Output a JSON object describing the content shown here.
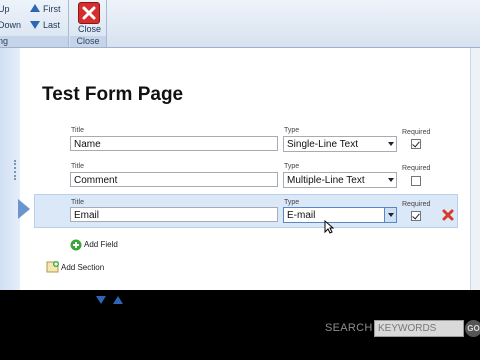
{
  "ribbon": {
    "up_label": "Up",
    "first_label": "First",
    "down_label": "Down",
    "last_label": "Last",
    "group_label_left": "ng",
    "close_label": "Close",
    "close_group_label": "Close"
  },
  "page": {
    "title": "Test Form Page"
  },
  "fields": [
    {
      "title_label": "Title",
      "title_value": "Name",
      "type_label": "Type",
      "type_value": "Single-Line Text",
      "required_label": "Required",
      "required": true
    },
    {
      "title_label": "Title",
      "title_value": "Comment",
      "type_label": "Type",
      "type_value": "Multiple-Line Text",
      "required_label": "Required",
      "required": false
    },
    {
      "title_label": "Title",
      "title_value": "Email",
      "type_label": "Type",
      "type_value": "E-mail",
      "required_label": "Required",
      "required": true
    }
  ],
  "actions": {
    "add_field": "Add Field",
    "add_section": "Add Section"
  },
  "search": {
    "label": "SEARCH",
    "placeholder": "KEYWORDS",
    "go": "GO"
  },
  "colors": {
    "delete": "#d63a2a",
    "selected_row": "#dbe8f8"
  }
}
